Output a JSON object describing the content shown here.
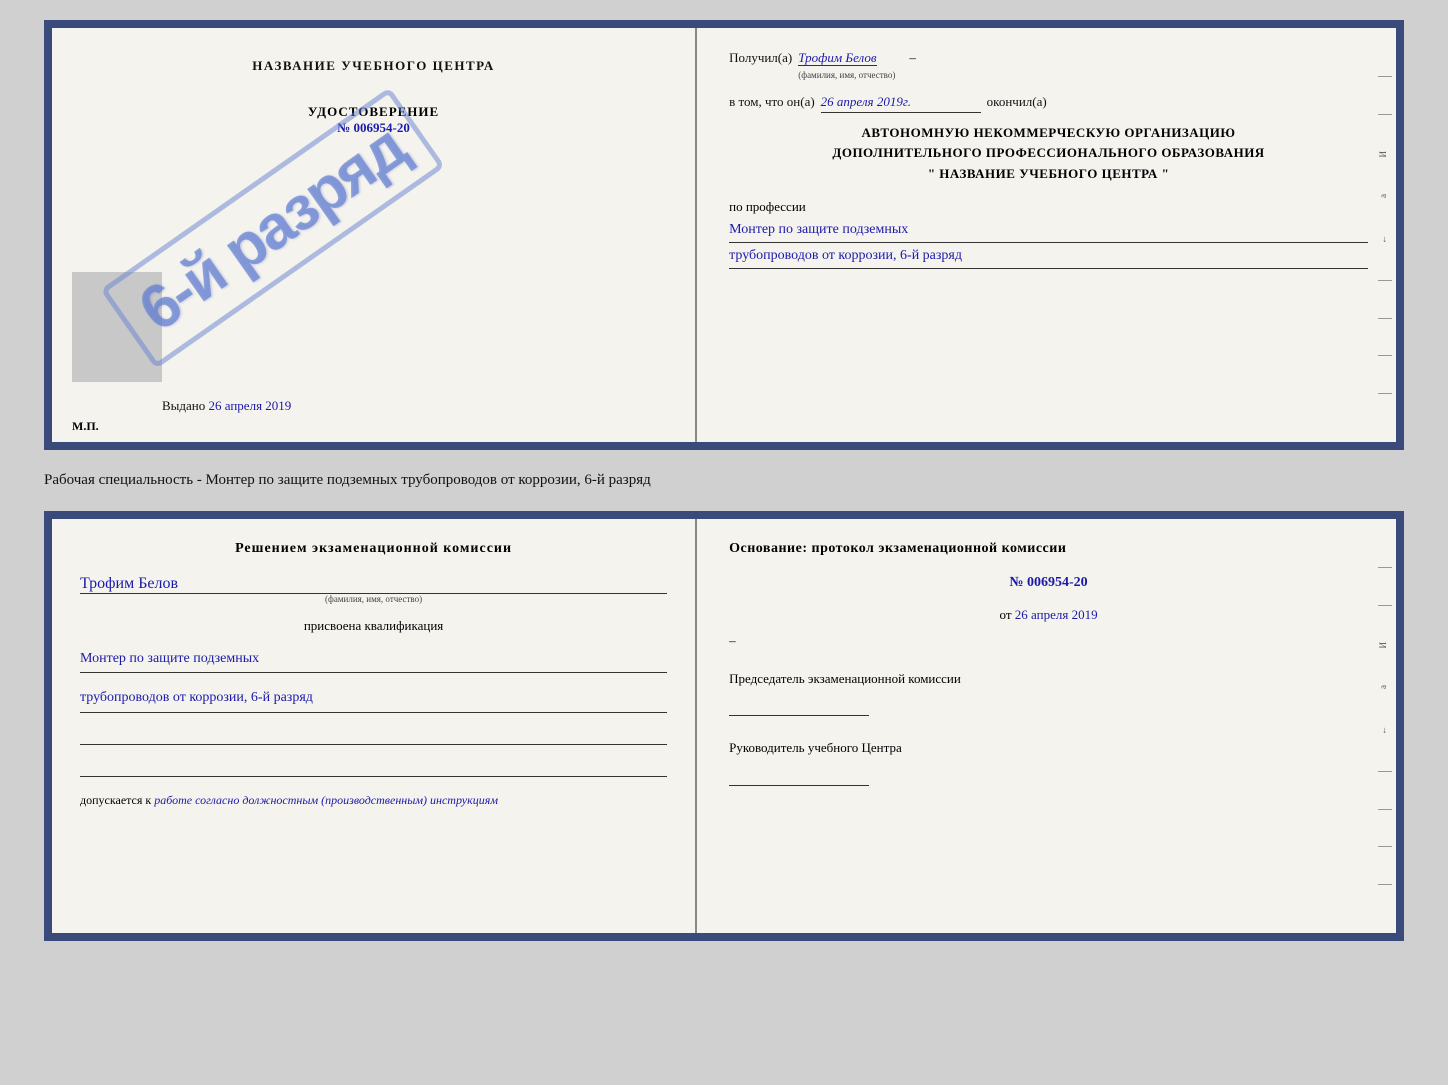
{
  "top_cert": {
    "left": {
      "title": "НАЗВАНИЕ УЧЕБНОГО ЦЕНТРА",
      "stamp_text": "6-й разряд",
      "udost_title": "УДОСТОВЕРЕНИЕ",
      "udost_number": "№ 006954-20",
      "vydano_label": "Выдано",
      "vydano_value": "26 апреля 2019",
      "mp": "М.П."
    },
    "right": {
      "poluchil_label": "Получил(а)",
      "fio_value": "Трофим Белов",
      "fio_sub": "(фамилия, имя, отчество)",
      "dash1": "–",
      "vtom_label": "в том, что он(а)",
      "date_value": "26 апреля 2019г.",
      "okonchil_label": "окончил(а)",
      "org_line1": "АВТОНОМНУЮ НЕКОММЕРЧЕСКУЮ ОРГАНИЗАЦИЮ",
      "org_line2": "ДОПОЛНИТЕЛЬНОГО ПРОФЕССИОНАЛЬНОГО ОБРАЗОВАНИЯ",
      "org_line3": "\" НАЗВАНИЕ УЧЕБНОГО ЦЕНТРА \"",
      "po_professii": "по профессии",
      "profession_line1": "Монтер по защите подземных",
      "profession_line2": "трубопроводов от коррозии, 6-й разряд"
    }
  },
  "specialty_text": "Рабочая специальность - Монтер по защите подземных трубопроводов от коррозии, 6-й разряд",
  "bottom_cert": {
    "left": {
      "decision_title": "Решением экзаменационной комиссии",
      "fio_value": "Трофим Белов",
      "fio_sub": "(фамилия, имя, отчество)",
      "assigned_label": "присвоена квалификация",
      "profession_line1": "Монтер по защите подземных",
      "profession_line2": "трубопроводов от коррозии, 6-й разряд",
      "допуск_label": "допускается к",
      "допуск_value": "работе согласно должностным (производственным) инструкциям"
    },
    "right": {
      "osnov_title": "Основание: протокол экзаменационной комиссии",
      "proto_number": "№ 006954-20",
      "ot_label": "от",
      "ot_value": "26 апреля 2019",
      "dash1": "–",
      "chairman_label": "Председатель экзаменационной комиссии",
      "rukov_label": "Руководитель учебного Центра"
    }
  },
  "edge_chars": {
    "char_i": "И",
    "char_a": "а",
    "char_arrow": "←"
  }
}
